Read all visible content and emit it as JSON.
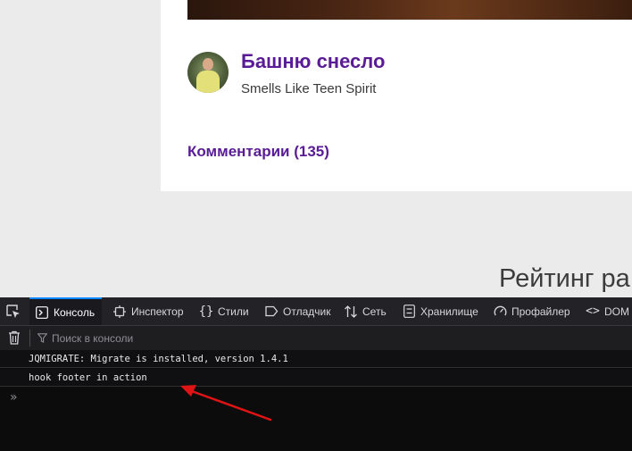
{
  "post": {
    "title": "Башню снесло",
    "subtitle": "Smells Like Teen Spirit",
    "comments_link": "Комментарии (135)"
  },
  "rating_heading": "Рейтинг ра",
  "devtools": {
    "tabs": [
      {
        "label": "Консоль",
        "icon": "console-icon",
        "active": true
      },
      {
        "label": "Инспектор",
        "icon": "inspector-icon"
      },
      {
        "label": "Стили",
        "icon": "braces-icon"
      },
      {
        "label": "Отладчик",
        "icon": "debugger-icon"
      },
      {
        "label": "Сеть",
        "icon": "network-icon"
      },
      {
        "label": "Хранилище",
        "icon": "storage-icon"
      },
      {
        "label": "Профайлер",
        "icon": "profiler-icon"
      },
      {
        "label": "DOM",
        "icon": "code-brackets-icon"
      }
    ],
    "filter_placeholder": "Поиск в консоли",
    "logs": [
      "JQMIGRATE: Migrate is installed, version 1.4.1",
      "hook footer in action"
    ],
    "prompt_symbol": "»"
  },
  "colors": {
    "accent": "#5a1b96",
    "devtools_active": "#0a84ff",
    "annotation": "#e01414"
  }
}
